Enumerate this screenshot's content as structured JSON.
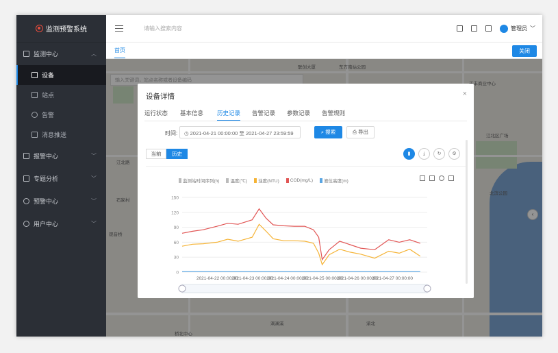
{
  "app": {
    "title": "监测预警系统"
  },
  "sidebar": {
    "groups": [
      {
        "label": "监测中心",
        "expanded": true,
        "items": [
          {
            "label": "设备",
            "active": true
          },
          {
            "label": "站点",
            "active": false
          },
          {
            "label": "告警",
            "active": false
          },
          {
            "label": "消息推送",
            "active": false
          }
        ]
      },
      {
        "label": "报警中心"
      },
      {
        "label": "专题分析"
      },
      {
        "label": "预警中心"
      },
      {
        "label": "用户中心"
      }
    ]
  },
  "topbar": {
    "search_placeholder": "请输入搜索内容",
    "user": "管理员"
  },
  "tabs": {
    "home": "首页",
    "close": "关闭"
  },
  "map": {
    "search_placeholder": "输入关键词，站点名称或者设备编码",
    "labels": [
      "联创大厦",
      "东方南站公园",
      "天丰商业中心",
      "江北区广场",
      "北滨公园",
      "江北路",
      "北滨路",
      "石家村",
      "观音桥",
      "桥北中心",
      "滨江路",
      "渝北",
      "龙溪",
      "南坪",
      "溉澜溪",
      "东港路"
    ]
  },
  "modal": {
    "title": "设备详情",
    "close": "×",
    "tabs": [
      "运行状态",
      "基本信息",
      "历史记录",
      "告警记录",
      "参数记录",
      "告警规则"
    ],
    "active_tab": 2,
    "time_label": "时间:",
    "time_range": "2021-04-21 00:00:00  至  2021-04-27 23:59:59",
    "search_btn": "搜索",
    "export_btn": "导出",
    "toggle_current": "当前",
    "toggle_history": "历史",
    "toggle_active": "history"
  },
  "chart_data": {
    "type": "line",
    "legend": [
      "监测站时间序列(h)",
      "温度(℃)",
      "浊度(NTU)",
      "COD(mg/L)",
      "液位高度(m)"
    ],
    "legend_colors": [
      "#bbbbbb",
      "#bbbbbb",
      "#f5b335",
      "#e15453",
      "#5aa6e3"
    ],
    "ylim": [
      0,
      150
    ],
    "yticks": [
      0,
      30,
      60,
      90,
      120,
      150
    ],
    "x_ticks": [
      "2021-04-22 00:00:00",
      "2021-04-23 00:00:00",
      "2021-04-24 00:00:00",
      "2021-04-25 00:00:00",
      "2021-04-26 00:00:00",
      "2021-04-27 00:00:00"
    ],
    "x_range_days": [
      21,
      28
    ],
    "series": [
      {
        "name": "COD(mg/L)",
        "color": "#e15453",
        "x": [
          21.0,
          21.3,
          21.6,
          22.0,
          22.3,
          22.6,
          23.0,
          23.2,
          23.4,
          23.6,
          23.9,
          24.2,
          24.5,
          24.75,
          24.9,
          25.0,
          25.2,
          25.5,
          25.8,
          26.1,
          26.5,
          26.9,
          27.2,
          27.5,
          27.8
        ],
        "values": [
          78,
          82,
          85,
          92,
          98,
          96,
          105,
          127,
          108,
          95,
          93,
          92,
          92,
          85,
          70,
          25,
          45,
          62,
          55,
          48,
          45,
          65,
          60,
          65,
          58
        ]
      },
      {
        "name": "浊度(NTU)",
        "color": "#f5b335",
        "x": [
          21.0,
          21.3,
          21.6,
          22.0,
          22.3,
          22.6,
          23.0,
          23.2,
          23.4,
          23.6,
          23.9,
          24.2,
          24.5,
          24.75,
          24.9,
          25.0,
          25.2,
          25.5,
          25.8,
          26.1,
          26.5,
          26.9,
          27.2,
          27.5,
          27.8
        ],
        "values": [
          52,
          56,
          57,
          60,
          66,
          62,
          70,
          96,
          82,
          67,
          63,
          63,
          62,
          58,
          38,
          15,
          35,
          46,
          40,
          36,
          28,
          42,
          38,
          46,
          32
        ]
      },
      {
        "name": "液位高度(m)",
        "color": "#5aa6e3",
        "x": [
          21.0,
          27.8
        ],
        "values": [
          1,
          1
        ]
      }
    ]
  }
}
